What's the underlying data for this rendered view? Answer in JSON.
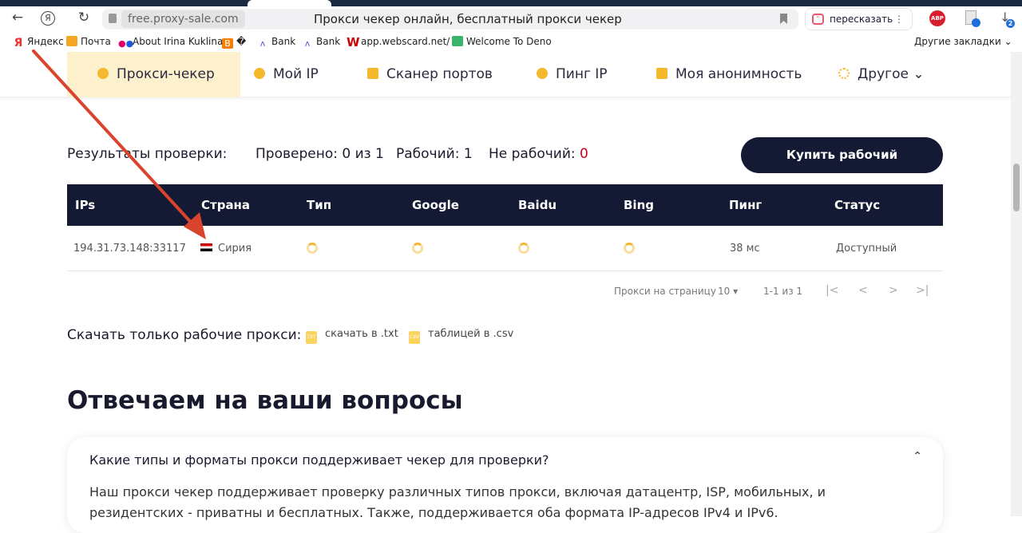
{
  "browser": {
    "url": "free.proxy-sale.com",
    "title": "Прокси чекер онлайн, бесплатный прокси чекер",
    "retell": "пересказать",
    "abp": "ABP",
    "download_count": "2",
    "bookmarks": [
      "Яндекс",
      "Почта",
      "About Irina Kuklina",
      "�",
      "Bank",
      "Bank",
      "app.webscard.net/",
      "Welcome To Deno"
    ],
    "other_bookmarks": "Другие закладки"
  },
  "nav": [
    "Прокси-чекер",
    "Мой IP",
    "Сканер портов",
    "Пинг IP",
    "Моя анонимность",
    "Другое"
  ],
  "results": {
    "label": "Результаты проверки:",
    "checked": "Проверено: 0 из 1",
    "working": "Рабочий: 1",
    "not_working_label": "Не рабочий:",
    "not_working_value": "0",
    "buy": "Купить рабочий"
  },
  "table": {
    "headers": [
      "IPs",
      "Страна",
      "Тип",
      "Google",
      "Baidu",
      "Bing",
      "Пинг",
      "Статус"
    ],
    "rows": [
      {
        "ip": "194.31.73.148:33117",
        "country": "Сирия",
        "ping": "38 мс",
        "status": "Доступный"
      }
    ]
  },
  "pager": {
    "label": "Прокси на страницу",
    "per_page": "10",
    "range": "1-1 из 1"
  },
  "download": {
    "label": "Скачать только рабочие прокси:",
    "txt": "скачать в .txt",
    "csv": "таблицей в .csv",
    "txt_icon": "TXT",
    "csv_icon": "CSV"
  },
  "faq": {
    "title": "Отвечаем на ваши вопросы",
    "q1": "Какие типы и форматы прокси поддерживает чекер для проверки?",
    "a1": "Наш прокси чекер поддерживает проверку различных типов прокси, включая датацентр, ISP, мобильных, и резидентских - приватны и бесплатных. Также, поддерживается оба формата IP-адресов IPv4 и IPv6."
  },
  "colors": {
    "accent": "#f5b82e",
    "dark": "#141a33",
    "danger": "#d0021b"
  }
}
